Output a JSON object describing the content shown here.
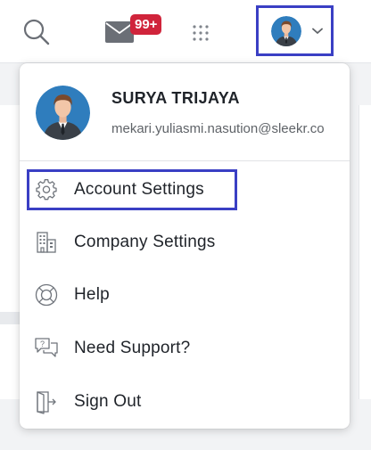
{
  "header": {
    "search_icon": "search-icon",
    "mail_icon": "mail-icon",
    "mail_badge": "99+",
    "apps_icon": "apps-grid-icon",
    "profile_icon": "user-avatar",
    "chevron_icon": "chevron-down-icon"
  },
  "profile_menu": {
    "user": {
      "name": "SURYA TRIJAYA",
      "email": "mekari.yuliasmi.nasution@sleekr.co"
    },
    "items": [
      {
        "label": "Account Settings",
        "icon": "gear-icon"
      },
      {
        "label": "Company Settings",
        "icon": "building-icon"
      },
      {
        "label": "Help",
        "icon": "lifebuoy-icon"
      },
      {
        "label": "Need Support?",
        "icon": "support-chat-icon"
      },
      {
        "label": "Sign Out",
        "icon": "sign-out-door-icon"
      }
    ]
  },
  "colors": {
    "accent_outline": "#3a3fc4",
    "badge": "#d0243b",
    "avatar_bg": "#2f7dbd",
    "icon": "#70757c"
  }
}
